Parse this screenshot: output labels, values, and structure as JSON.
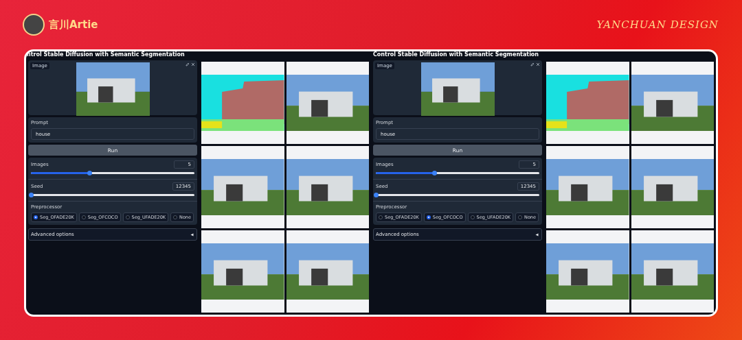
{
  "header": {
    "author": "言川Artie",
    "brand": "YANCHUAN DESIGN"
  },
  "apps": [
    {
      "title": "ntrol Stable Diffusion with Semantic Segmentation",
      "image_label": "Image",
      "prompt_label": "Prompt",
      "prompt_value": "house",
      "run": "Run",
      "sliders": [
        {
          "label": "Images",
          "value": "5",
          "level": 0.36
        },
        {
          "label": "Seed",
          "value": "12345",
          "level": 0
        }
      ],
      "preprocessor_label": "Preprocessor",
      "options": [
        {
          "label": "Seg_OFADE20K",
          "selected": true
        },
        {
          "label": "Seg_OFCOCO",
          "selected": false
        },
        {
          "label": "Seg_UFADE20K",
          "selected": false
        },
        {
          "label": "None",
          "selected": false
        }
      ],
      "advanced": "Advanced options",
      "gallery": [
        {
          "kind": "segmentation"
        },
        {
          "kind": "photo"
        },
        {
          "kind": "photo"
        },
        {
          "kind": "photo"
        },
        {
          "kind": "photo"
        },
        {
          "kind": "photo"
        }
      ]
    },
    {
      "title": "Control Stable Diffusion with Semantic Segmentation",
      "image_label": "Image",
      "prompt_label": "Prompt",
      "prompt_value": "house",
      "run": "Run",
      "sliders": [
        {
          "label": "Images",
          "value": "5",
          "level": 0.36
        },
        {
          "label": "Seed",
          "value": "12345",
          "level": 0
        }
      ],
      "preprocessor_label": "Preprocessor",
      "options": [
        {
          "label": "Seg_OFADE20K",
          "selected": false
        },
        {
          "label": "Seg_OFCOCO",
          "selected": true
        },
        {
          "label": "Seg_UFADE20K",
          "selected": false
        },
        {
          "label": "None",
          "selected": false
        }
      ],
      "advanced": "Advanced options",
      "gallery": [
        {
          "kind": "segmentation"
        },
        {
          "kind": "photo"
        },
        {
          "kind": "photo"
        },
        {
          "kind": "photo"
        },
        {
          "kind": "photo"
        },
        {
          "kind": "photo"
        }
      ]
    }
  ]
}
